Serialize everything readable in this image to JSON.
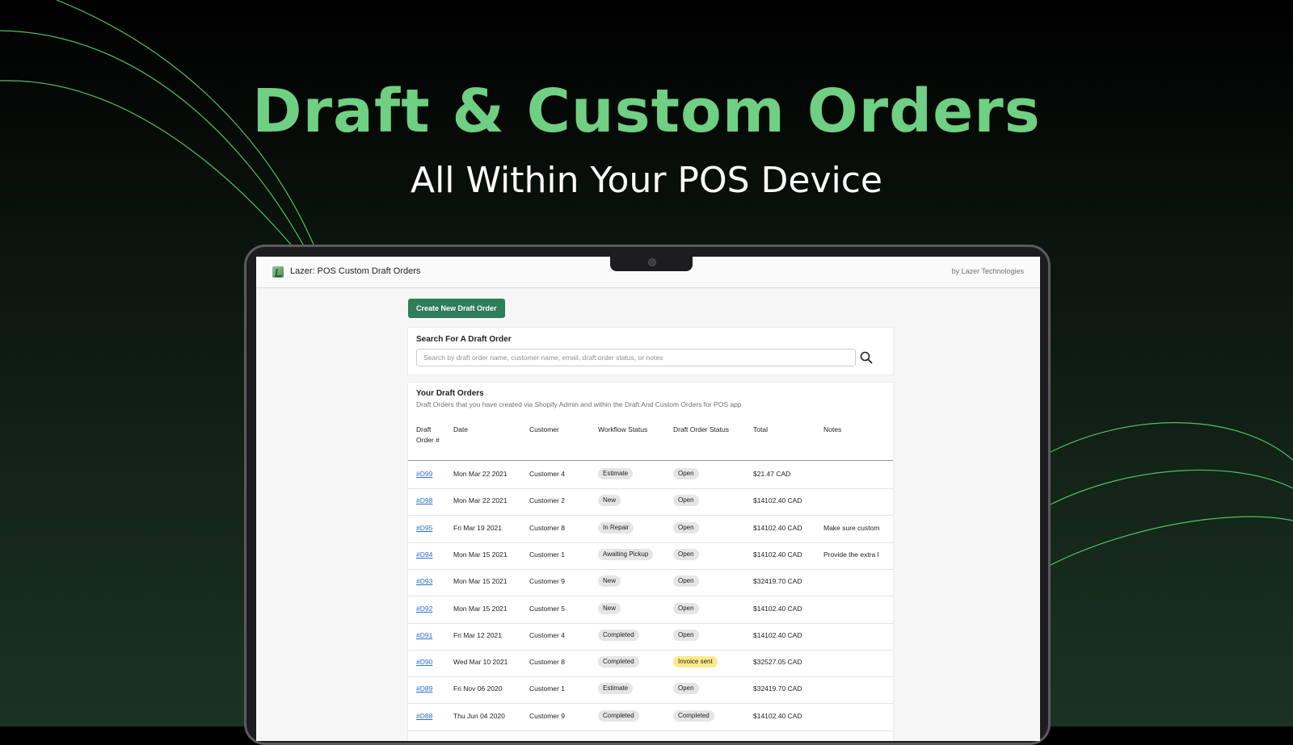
{
  "hero": {
    "title": "Draft & Custom Orders",
    "subtitle": "All Within Your POS Device"
  },
  "colors": {
    "accent": "#6fcf82",
    "deco_line": "#5ad06f",
    "primary_button": "#2e7d5b",
    "link": "#2c6ecb",
    "badge": "#e4e5e7",
    "badge_warning": "#ffea8a"
  },
  "app": {
    "title": "Lazer: POS Custom Draft Orders",
    "by": "by Lazer Technologies",
    "logo_icon": "app-logo-icon"
  },
  "actions": {
    "create_label": "Create New Draft Order"
  },
  "search": {
    "heading": "Search For A Draft Order",
    "placeholder": "Search by draft order name, customer name, email, draft order status, or notes",
    "icon": "search-icon"
  },
  "orders": {
    "heading": "Your Draft Orders",
    "subtitle": "Draft Orders that you have created via Shopify Admin and within the Draft And Custom Orders for POS app",
    "columns": [
      "Draft Order #",
      "Date",
      "Customer",
      "Workflow Status",
      "Draft Order Status",
      "Total",
      "Notes"
    ],
    "rows": [
      {
        "id": "#D99",
        "date": "Mon Mar 22 2021",
        "customer": "Customer 4",
        "workflow": "Estimate",
        "status": "Open",
        "total": "$21.47 CAD",
        "notes": ""
      },
      {
        "id": "#D98",
        "date": "Mon Mar 22 2021",
        "customer": "Customer 2",
        "workflow": "New",
        "status": "Open",
        "total": "$14102.40 CAD",
        "notes": ""
      },
      {
        "id": "#D95",
        "date": "Fri Mar 19 2021",
        "customer": "Customer 8",
        "workflow": "In Repair",
        "status": "Open",
        "total": "$14102.40 CAD",
        "notes": "Make sure custom"
      },
      {
        "id": "#D94",
        "date": "Mon Mar 15 2021",
        "customer": "Customer 1",
        "workflow": "Awaiting Pickup",
        "status": "Open",
        "total": "$14102.40 CAD",
        "notes": "Provide the extra l"
      },
      {
        "id": "#D93",
        "date": "Mon Mar 15 2021",
        "customer": "Customer 9",
        "workflow": "New",
        "status": "Open",
        "total": "$32419.70 CAD",
        "notes": ""
      },
      {
        "id": "#D92",
        "date": "Mon Mar 15 2021",
        "customer": "Customer 5",
        "workflow": "New",
        "status": "Open",
        "total": "$14102.40 CAD",
        "notes": ""
      },
      {
        "id": "#D91",
        "date": "Fri Mar 12 2021",
        "customer": "Customer 4",
        "workflow": "Completed",
        "status": "Open",
        "total": "$14102.40 CAD",
        "notes": ""
      },
      {
        "id": "#D90",
        "date": "Wed Mar 10 2021",
        "customer": "Customer 8",
        "workflow": "Completed",
        "status": "Invoice sent",
        "total": "$32527.05 CAD",
        "notes": ""
      },
      {
        "id": "#D89",
        "date": "Fri Nov 06 2020",
        "customer": "Customer 1",
        "workflow": "Estimate",
        "status": "Open",
        "total": "$32419.70 CAD",
        "notes": ""
      },
      {
        "id": "#D88",
        "date": "Thu Jun 04 2020",
        "customer": "Customer 9",
        "workflow": "Completed",
        "status": "Completed",
        "total": "$14102.40 CAD",
        "notes": ""
      }
    ]
  }
}
